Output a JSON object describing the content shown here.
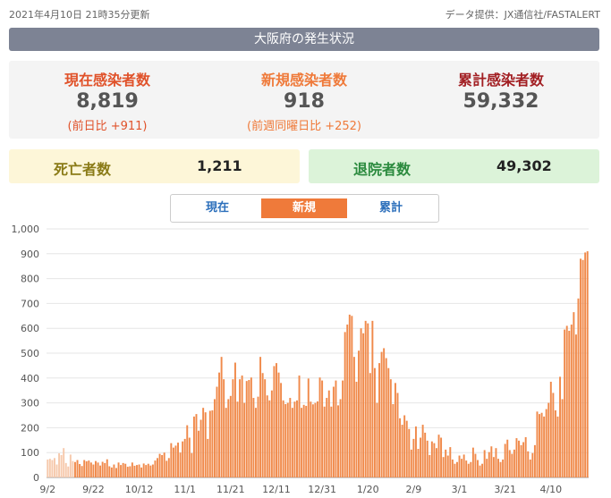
{
  "header": {
    "updated": "2021年4月10日 21時35分更新",
    "source": "データ提供：JX通信社/FASTALERT"
  },
  "title": "大阪府の発生状況",
  "stats": {
    "current": {
      "label": "現在感染者数",
      "value": "8,819",
      "sub": "(前日比 +911)",
      "color": "#e0522a"
    },
    "new": {
      "label": "新規感染者数",
      "value": "918",
      "sub": "(前週同曜日比 +252)",
      "color": "#ef7a3a"
    },
    "total": {
      "label": "累計感染者数",
      "value": "59,332",
      "color": "#a21f23"
    }
  },
  "deaths": {
    "label": "死亡者数",
    "value": "1,211",
    "color": "#8a7b17"
  },
  "recovered": {
    "label": "退院者数",
    "value": "49,302",
    "color": "#2b8a3e"
  },
  "tabs": [
    {
      "label": "現在",
      "active": false
    },
    {
      "label": "新規",
      "active": true
    },
    {
      "label": "累計",
      "active": false
    }
  ],
  "chart_data": {
    "type": "bar",
    "ylim": [
      0,
      1000
    ],
    "yticks": [
      "0",
      "100",
      "200",
      "300",
      "400",
      "500",
      "600",
      "700",
      "800",
      "900",
      "1,000"
    ],
    "xticks": [
      {
        "label": "9/2",
        "index": 0
      },
      {
        "label": "9/22",
        "index": 20
      },
      {
        "label": "10/12",
        "index": 40
      },
      {
        "label": "11/1",
        "index": 60
      },
      {
        "label": "11/21",
        "index": 80
      },
      {
        "label": "12/11",
        "index": 100
      },
      {
        "label": "12/31",
        "index": 120
      },
      {
        "label": "1/20",
        "index": 140
      },
      {
        "label": "2/9",
        "index": 160
      },
      {
        "label": "3/1",
        "index": 180
      },
      {
        "label": "3/21",
        "index": 200
      },
      {
        "label": "4/10",
        "index": 220
      }
    ],
    "bar_color": "#f08a4b",
    "values": [
      72,
      75,
      70,
      78,
      52,
      97,
      90,
      118,
      58,
      44,
      92,
      66,
      62,
      70,
      54,
      46,
      70,
      65,
      68,
      60,
      52,
      66,
      60,
      48,
      63,
      58,
      73,
      45,
      40,
      52,
      38,
      60,
      50,
      58,
      55,
      43,
      45,
      60,
      47,
      50,
      52,
      40,
      56,
      50,
      55,
      48,
      52,
      68,
      78,
      95,
      90,
      100,
      67,
      78,
      138,
      120,
      128,
      140,
      100,
      145,
      155,
      210,
      160,
      98,
      245,
      255,
      188,
      232,
      280,
      262,
      155,
      268,
      270,
      315,
      365,
      422,
      485,
      395,
      280,
      315,
      328,
      395,
      462,
      305,
      395,
      410,
      300,
      388,
      392,
      402,
      320,
      280,
      325,
      485,
      420,
      395,
      330,
      310,
      350,
      448,
      460,
      422,
      380,
      310,
      295,
      300,
      320,
      280,
      305,
      310,
      410,
      280,
      292,
      288,
      398,
      305,
      294,
      300,
      306,
      402,
      390,
      285,
      320,
      350,
      285,
      365,
      390,
      290,
      315,
      390,
      585,
      615,
      655,
      650,
      485,
      385,
      510,
      600,
      580,
      630,
      620,
      420,
      630,
      440,
      300,
      460,
      505,
      520,
      480,
      440,
      395,
      295,
      380,
      340,
      238,
      212,
      250,
      228,
      195,
      112,
      155,
      205,
      115,
      160,
      212,
      180,
      148,
      90,
      145,
      138,
      118,
      172,
      160,
      82,
      112,
      88,
      122,
      72,
      55,
      62,
      88,
      75,
      92,
      68,
      55,
      62,
      120,
      95,
      70,
      48,
      55,
      110,
      75,
      102,
      125,
      82,
      118,
      75,
      62,
      72,
      135,
      152,
      110,
      95,
      112,
      158,
      148,
      130,
      142,
      162,
      105,
      72,
      98,
      130,
      265,
      255,
      260,
      245,
      275,
      300,
      385,
      340,
      270,
      245,
      405,
      315,
      595,
      610,
      590,
      615,
      665,
      575,
      720,
      880,
      875,
      905,
      910
    ]
  }
}
